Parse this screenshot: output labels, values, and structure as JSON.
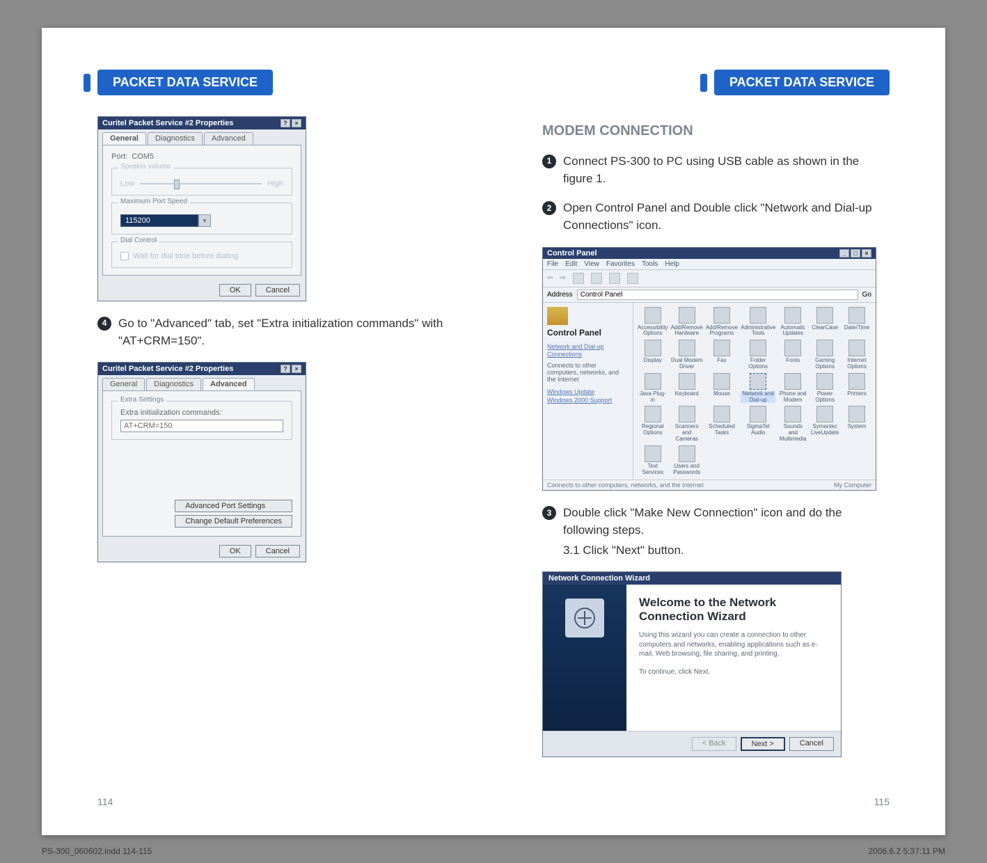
{
  "header": {
    "left_tab": "PACKET DATA SERVICE",
    "right_tab": "PACKET DATA SERVICE"
  },
  "left": {
    "step4_text": "Go to \"Advanced\" tab, set \"Extra initialization commands\" with \"AT+CRM=150\".",
    "dlg1": {
      "title": "Curitel Packet Service #2 Properties",
      "tabs": {
        "general": "General",
        "diagnostics": "Diagnostics",
        "advanced": "Advanced"
      },
      "port_label": "Port:",
      "port_value": "COM5",
      "speaker_legend": "Speaker volume",
      "speaker_low": "Low",
      "speaker_high": "High",
      "max_legend": "Maximum Port Speed",
      "max_value": "115200",
      "dial_legend": "Dial Control",
      "dial_check": "Wait for dial tone before dialing",
      "ok": "OK",
      "cancel": "Cancel"
    },
    "dlg2": {
      "title": "Curitel Packet Service #2 Properties",
      "tabs": {
        "general": "General",
        "diagnostics": "Diagnostics",
        "advanced": "Advanced"
      },
      "extra_legend": "Extra Settings",
      "extra_label": "Extra initialization commands:",
      "extra_value": "AT+CRM=150",
      "adv_port": "Advanced Port Settings",
      "chg_def": "Change Default Preferences",
      "ok": "OK",
      "cancel": "Cancel"
    }
  },
  "right": {
    "section_heading": "MODEM CONNECTION",
    "step1_text": "Connect PS-300 to PC using USB cable as shown in the figure 1.",
    "step2_text": "Open Control Panel and Double click \"Network and Dial-up Connections\" icon.",
    "step3_text": "Double click \"Make New Connection\" icon and do the following steps.",
    "step3_sub": "3.1 Click \"Next\" button.",
    "control_panel": {
      "title": "Control Panel",
      "menu": [
        "File",
        "Edit",
        "View",
        "Favorites",
        "Tools",
        "Help"
      ],
      "address_label": "Address",
      "address_value": "Control Panel",
      "go": "Go",
      "side_title": "Control Panel",
      "side_desc1": "Network and Dial-up Connections",
      "side_desc2": "Connects to other computers, networks, and the Internet",
      "side_link1": "Windows Update",
      "side_link2": "Windows 2000 Support",
      "items": [
        "Accessibility Options",
        "Add/Remove Hardware",
        "Add/Remove Programs",
        "Administrative Tools",
        "Automatic Updates",
        "ClearCase",
        "Date/Time",
        "Display",
        "Dual Modem Driver",
        "Fax",
        "Folder Options",
        "Fonts",
        "Gaming Options",
        "Internet Options",
        "Java Plug-in",
        "Keyboard",
        "Mouse",
        "Network and Dial-up",
        "Phone and Modem",
        "Power Options",
        "Printers",
        "Regional Options",
        "Scanners and Cameras",
        "Scheduled Tasks",
        "SigmaTel Audio",
        "Sounds and Multimedia",
        "Symantec LiveUpdate",
        "System",
        "Text Services",
        "Users and Passwords",
        "",
        ""
      ],
      "status_left": "Connects to other computers, networks, and the Internet",
      "status_right": "My Computer"
    },
    "wizard": {
      "title": "Network Connection Wizard",
      "heading": "Welcome to the Network Connection Wizard",
      "para": "Using this wizard you can create a connection to other computers and networks, enabling applications such as e-mail, Web browsing, file sharing, and printing.",
      "cont": "To continue, click Next.",
      "back": "< Back",
      "next": "Next >",
      "cancel": "Cancel"
    }
  },
  "footer": {
    "left_page": "114",
    "right_page": "115"
  },
  "print": {
    "file": "PS-300_060602.indd   114-115",
    "stamp": "2006.6.2   5:37:11 PM"
  }
}
